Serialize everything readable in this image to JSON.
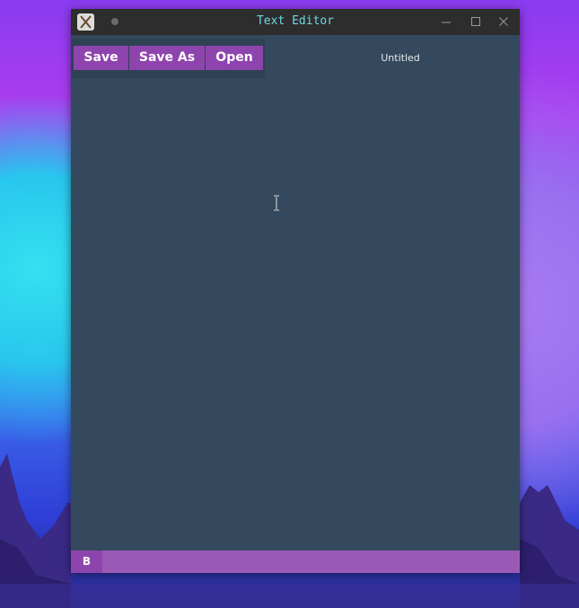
{
  "window": {
    "title": "Text Editor"
  },
  "toolbar": {
    "save_label": "Save",
    "save_as_label": "Save As",
    "open_label": "Open"
  },
  "document": {
    "filename": "Untitled"
  },
  "statusbar": {
    "bold_label": "B"
  },
  "colors": {
    "button_purple": "#8e44ad",
    "statusbar_purple": "#9b59b6",
    "editor_bg": "#34495e",
    "title_text": "#6fd8e4"
  },
  "icons": {
    "app": "app-icon",
    "pin": "pin-icon",
    "minimize": "minimize-icon",
    "maximize": "maximize-icon",
    "close": "close-icon",
    "text_cursor": "text-cursor-icon"
  }
}
